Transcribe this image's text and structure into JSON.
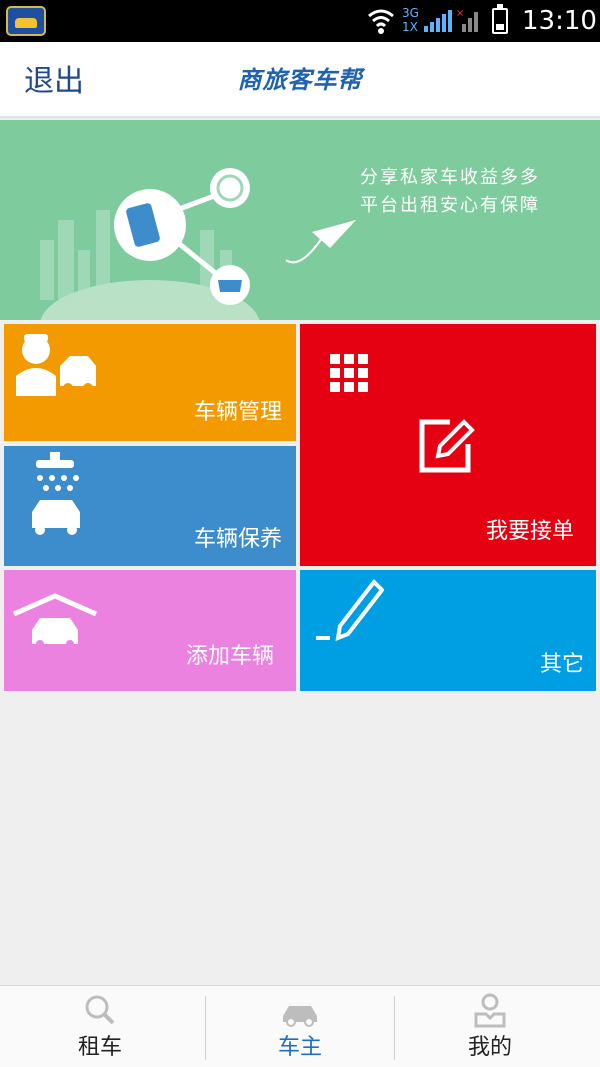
{
  "status_bar": {
    "network_label": "3G\n1X",
    "time": "13:10"
  },
  "header": {
    "back_label": "退出",
    "title": "商旅客车帮"
  },
  "banner": {
    "line1": "分享私家车收益多多",
    "line2": "平台出租安心有保障"
  },
  "tiles": {
    "vehicle_manage": "车辆管理",
    "vehicle_maintenance": "车辆保养",
    "add_vehicle": "添加车辆",
    "accept_order": "我要接单",
    "other": "其它"
  },
  "colors": {
    "orange": "#f29a00",
    "blue": "#3d8ccc",
    "pink": "#ec82e0",
    "red": "#e50012",
    "sky": "#009fe3",
    "banner_green": "#7ecb9e",
    "active_nav": "#1f6fc0"
  },
  "bottom_nav": {
    "items": [
      {
        "label": "租车",
        "icon": "magnifier-icon",
        "active": false
      },
      {
        "label": "车主",
        "icon": "car-icon",
        "active": true
      },
      {
        "label": "我的",
        "icon": "user-icon",
        "active": false
      }
    ]
  }
}
